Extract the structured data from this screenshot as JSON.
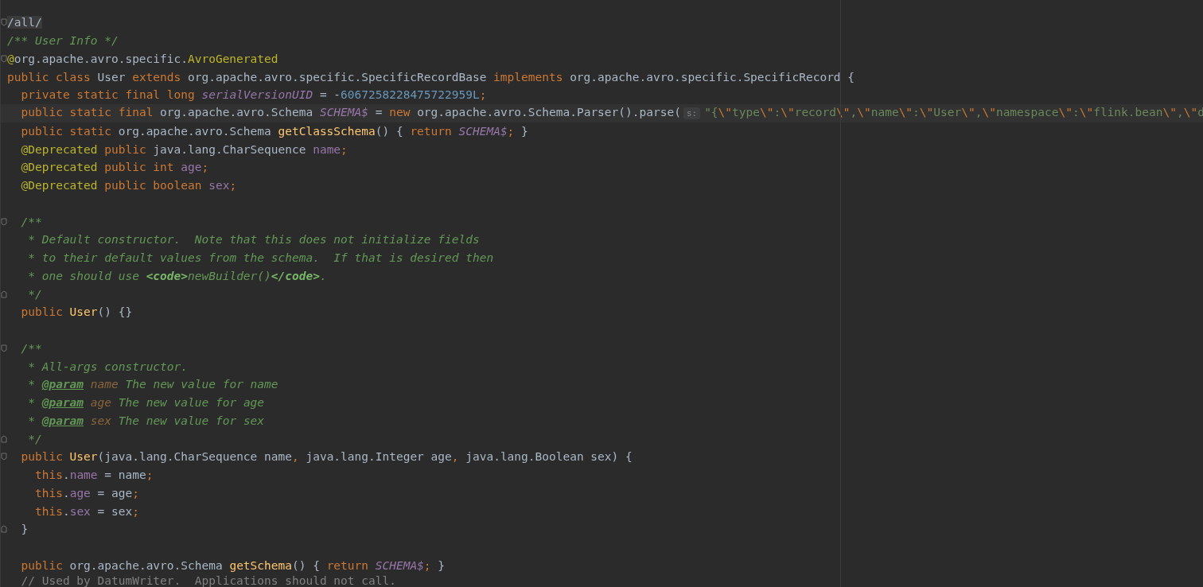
{
  "editor": {
    "lines": [
      {
        "fold_start": true,
        "tokens": [
          {
            "kind": "marked",
            "text": "/all/"
          }
        ]
      },
      {
        "tokens": [
          {
            "kind": "doc",
            "text": "/** User Info */"
          }
        ]
      },
      {
        "fold_start": true,
        "tokens": [
          {
            "kind": "annotation",
            "text": "@"
          },
          {
            "kind": "plain",
            "text": "org.apache.avro.specific."
          },
          {
            "kind": "annotation",
            "text": "AvroGenerated"
          }
        ]
      },
      {
        "tokens": [
          {
            "kind": "keyword",
            "text": "public class "
          },
          {
            "kind": "plain",
            "text": "User "
          },
          {
            "kind": "keyword",
            "text": "extends "
          },
          {
            "kind": "plain",
            "text": "org.apache.avro.specific.SpecificRecordBase "
          },
          {
            "kind": "keyword",
            "text": "implements "
          },
          {
            "kind": "plain",
            "text": "org.apache.avro.specific.SpecificRecord {"
          }
        ]
      },
      {
        "in_class": true,
        "tokens": [
          {
            "kind": "keyword",
            "text": "private static final long "
          },
          {
            "kind": "static",
            "text": "serialVersionUID"
          },
          {
            "kind": "plain",
            "text": " = -"
          },
          {
            "kind": "number",
            "text": "6067258228475722959L"
          },
          {
            "kind": "keyword",
            "text": ";"
          }
        ]
      },
      {
        "in_class": true,
        "current": true,
        "tokens": [
          {
            "kind": "keyword",
            "text": "public static final "
          },
          {
            "kind": "plain",
            "text": "org.apache.avro.Schema "
          },
          {
            "kind": "static",
            "text": "SCHEMA$"
          },
          {
            "kind": "plain",
            "text": " = "
          },
          {
            "kind": "keyword",
            "text": "new "
          },
          {
            "kind": "plain",
            "text": "org.apache.avro.Schema.Parser().parse("
          },
          {
            "kind": "hint",
            "text": "s:"
          },
          {
            "kind": "string",
            "text": "\"{"
          },
          {
            "kind": "escape",
            "text": "\\\""
          },
          {
            "kind": "string",
            "text": "type"
          },
          {
            "kind": "escape",
            "text": "\\\""
          },
          {
            "kind": "string",
            "text": ":"
          },
          {
            "kind": "escape",
            "text": "\\\""
          },
          {
            "kind": "string",
            "text": "record"
          },
          {
            "kind": "escape",
            "text": "\\\""
          },
          {
            "kind": "string",
            "text": ","
          },
          {
            "kind": "escape",
            "text": "\\\""
          },
          {
            "kind": "string",
            "text": "name"
          },
          {
            "kind": "escape",
            "text": "\\\""
          },
          {
            "kind": "string",
            "text": ":"
          },
          {
            "kind": "escape",
            "text": "\\\""
          },
          {
            "kind": "string",
            "text": "User"
          },
          {
            "kind": "escape",
            "text": "\\\""
          },
          {
            "kind": "string",
            "text": ","
          },
          {
            "kind": "escape",
            "text": "\\\""
          },
          {
            "kind": "string",
            "text": "namespace"
          },
          {
            "kind": "escape",
            "text": "\\\""
          },
          {
            "kind": "string",
            "text": ":"
          },
          {
            "kind": "escape",
            "text": "\\\""
          },
          {
            "kind": "string",
            "text": "flink.bean"
          },
          {
            "kind": "escape",
            "text": "\\\""
          },
          {
            "kind": "string",
            "text": ","
          },
          {
            "kind": "escape",
            "text": "\\\""
          },
          {
            "kind": "string",
            "text": "d"
          }
        ]
      },
      {
        "in_class": true,
        "tokens": [
          {
            "kind": "keyword",
            "text": "public static "
          },
          {
            "kind": "plain",
            "text": "org.apache.avro.Schema "
          },
          {
            "kind": "method",
            "text": "getClassSchema"
          },
          {
            "kind": "plain",
            "text": "() { "
          },
          {
            "kind": "keyword",
            "text": "return "
          },
          {
            "kind": "static",
            "text": "SCHEMA$"
          },
          {
            "kind": "keyword",
            "text": ";"
          },
          {
            "kind": "plain",
            "text": " }"
          }
        ]
      },
      {
        "in_class": true,
        "tokens": [
          {
            "kind": "annotation",
            "text": "@Deprecated "
          },
          {
            "kind": "keyword",
            "text": "public "
          },
          {
            "kind": "plain",
            "text": "java.lang.CharSequence "
          },
          {
            "kind": "field",
            "text": "name"
          },
          {
            "kind": "keyword",
            "text": ";"
          }
        ]
      },
      {
        "in_class": true,
        "tokens": [
          {
            "kind": "annotation",
            "text": "@Deprecated "
          },
          {
            "kind": "keyword",
            "text": "public int "
          },
          {
            "kind": "field",
            "text": "age"
          },
          {
            "kind": "keyword",
            "text": ";"
          }
        ]
      },
      {
        "in_class": true,
        "tokens": [
          {
            "kind": "annotation",
            "text": "@Deprecated "
          },
          {
            "kind": "keyword",
            "text": "public boolean "
          },
          {
            "kind": "field",
            "text": "sex"
          },
          {
            "kind": "keyword",
            "text": ";"
          }
        ]
      },
      {
        "in_class": true,
        "gap_before": true,
        "fold_start": true,
        "tokens": [
          {
            "kind": "doc",
            "text": "/**"
          }
        ]
      },
      {
        "in_class": true,
        "tokens": [
          {
            "kind": "doc",
            "text": " * Default constructor.  Note that this does not initialize fields"
          }
        ]
      },
      {
        "in_class": true,
        "tokens": [
          {
            "kind": "doc",
            "text": " * to their default values from the schema.  If that is desired then"
          }
        ]
      },
      {
        "in_class": true,
        "tokens": [
          {
            "kind": "doc",
            "text": " * one should use "
          },
          {
            "kind": "doc-tag",
            "text": "<code>"
          },
          {
            "kind": "doc",
            "text": "newBuilder()"
          },
          {
            "kind": "doc-tag",
            "text": "</code>"
          },
          {
            "kind": "doc",
            "text": "."
          }
        ]
      },
      {
        "in_class": true,
        "fold_end": true,
        "tokens": [
          {
            "kind": "doc",
            "text": " */"
          }
        ]
      },
      {
        "in_class": true,
        "tokens": [
          {
            "kind": "keyword",
            "text": "public "
          },
          {
            "kind": "method",
            "text": "User"
          },
          {
            "kind": "plain",
            "text": "() {}"
          }
        ]
      },
      {
        "in_class": true,
        "gap_before": true,
        "fold_start": true,
        "tokens": [
          {
            "kind": "doc",
            "text": "/**"
          }
        ]
      },
      {
        "in_class": true,
        "tokens": [
          {
            "kind": "doc",
            "text": " * All-args constructor."
          }
        ]
      },
      {
        "in_class": true,
        "tokens": [
          {
            "kind": "doc",
            "text": " * "
          },
          {
            "kind": "param-tag",
            "text": "@param"
          },
          {
            "kind": "param-name",
            "text": " name"
          },
          {
            "kind": "doc",
            "text": " The new value for name"
          }
        ]
      },
      {
        "in_class": true,
        "tokens": [
          {
            "kind": "doc",
            "text": " * "
          },
          {
            "kind": "param-tag",
            "text": "@param"
          },
          {
            "kind": "param-name",
            "text": " age"
          },
          {
            "kind": "doc",
            "text": " The new value for age"
          }
        ]
      },
      {
        "in_class": true,
        "tokens": [
          {
            "kind": "doc",
            "text": " * "
          },
          {
            "kind": "param-tag",
            "text": "@param"
          },
          {
            "kind": "param-name",
            "text": " sex"
          },
          {
            "kind": "doc",
            "text": " The new value for sex"
          }
        ]
      },
      {
        "in_class": true,
        "fold_end": true,
        "tokens": [
          {
            "kind": "doc",
            "text": " */"
          }
        ]
      },
      {
        "in_class": true,
        "fold_start": true,
        "tokens": [
          {
            "kind": "keyword",
            "text": "public "
          },
          {
            "kind": "method",
            "text": "User"
          },
          {
            "kind": "plain",
            "text": "(java.lang.CharSequence name"
          },
          {
            "kind": "keyword",
            "text": ", "
          },
          {
            "kind": "plain",
            "text": "java.lang.Integer age"
          },
          {
            "kind": "keyword",
            "text": ", "
          },
          {
            "kind": "plain",
            "text": "java.lang.Boolean sex) {"
          }
        ]
      },
      {
        "in_class": true,
        "in_method": true,
        "tokens": [
          {
            "kind": "keyword",
            "text": "this"
          },
          {
            "kind": "plain",
            "text": "."
          },
          {
            "kind": "field",
            "text": "name"
          },
          {
            "kind": "plain",
            "text": " = name"
          },
          {
            "kind": "keyword",
            "text": ";"
          }
        ]
      },
      {
        "in_class": true,
        "in_method": true,
        "tokens": [
          {
            "kind": "keyword",
            "text": "this"
          },
          {
            "kind": "plain",
            "text": "."
          },
          {
            "kind": "field",
            "text": "age"
          },
          {
            "kind": "plain",
            "text": " = age"
          },
          {
            "kind": "keyword",
            "text": ";"
          }
        ]
      },
      {
        "in_class": true,
        "in_method": true,
        "tokens": [
          {
            "kind": "keyword",
            "text": "this"
          },
          {
            "kind": "plain",
            "text": "."
          },
          {
            "kind": "field",
            "text": "sex"
          },
          {
            "kind": "plain",
            "text": " = sex"
          },
          {
            "kind": "keyword",
            "text": ";"
          }
        ]
      },
      {
        "in_class": true,
        "fold_end": true,
        "tokens": [
          {
            "kind": "plain",
            "text": "}"
          }
        ]
      },
      {
        "in_class": true,
        "gap_before": true,
        "tokens": [
          {
            "kind": "keyword",
            "text": "public "
          },
          {
            "kind": "plain",
            "text": "org.apache.avro.Schema "
          },
          {
            "kind": "method",
            "text": "getSchema"
          },
          {
            "kind": "plain",
            "text": "() { "
          },
          {
            "kind": "keyword",
            "text": "return "
          },
          {
            "kind": "static",
            "text": "SCHEMA$"
          },
          {
            "kind": "keyword",
            "text": ";"
          },
          {
            "kind": "plain",
            "text": " }"
          }
        ]
      },
      {
        "in_class": true,
        "tokens": [
          {
            "kind": "comment",
            "text": "// Used by DatumWriter.  Applications should not call."
          }
        ]
      }
    ]
  }
}
